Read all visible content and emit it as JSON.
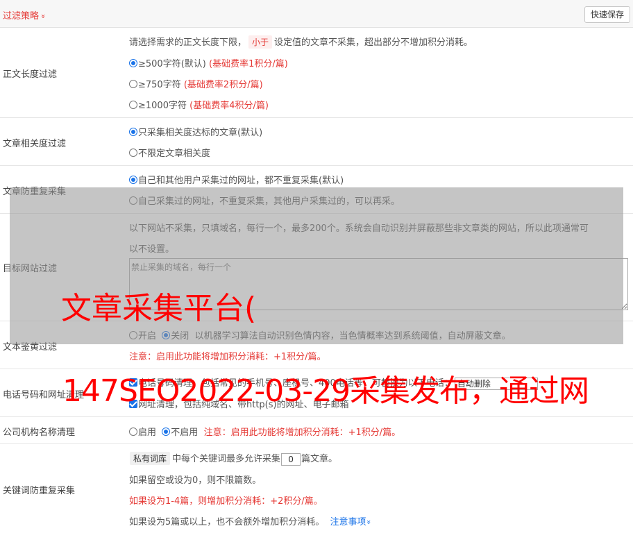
{
  "header": {
    "title": "过滤策略",
    "chevron": "»",
    "save_label": "快速保存"
  },
  "length_filter": {
    "label": "正文长度过滤",
    "desc_pre": "请选择需求的正文长度下限，",
    "desc_tag": "小于",
    "desc_post": "设定值的文章不采集，超出部分不增加积分消耗。",
    "options": [
      {
        "text": "≥500字符(默认)",
        "note": "(基础费率1积分/篇)",
        "selected": true
      },
      {
        "text": "≥750字符",
        "note": "(基础费率2积分/篇)",
        "selected": false
      },
      {
        "text": "≥1000字符",
        "note": "(基础费率4积分/篇)",
        "selected": false
      }
    ]
  },
  "relevance": {
    "label": "文章相关度过滤",
    "options": [
      {
        "text": "只采集相关度达标的文章(默认)",
        "selected": true
      },
      {
        "text": "不限定文章相关度",
        "selected": false
      }
    ]
  },
  "dedupe": {
    "label": "文章防重复采集",
    "options": [
      {
        "text": "自己和其他用户采集过的网址，都不重复采集(默认)",
        "selected": true
      },
      {
        "text": "自己采集过的网址，不重复采集，其他用户采集过的，可以再采。",
        "selected": false
      }
    ]
  },
  "site_filter": {
    "label": "目标网站过滤",
    "desc_line1": "以下网站不采集，只填域名，每行一个，最多200个。系统会自动识别并屏蔽那些非文章类的网站，所以此项通常可",
    "desc_line2": "以不设置。",
    "placeholder": "禁止采集的域名，每行一个"
  },
  "porn": {
    "label": "文本鉴黄过滤",
    "on_label": "开启",
    "off_label": "关闭",
    "desc": "以机器学习算法自动识别色情内容，当色情概率达到系统阈值，自动屏蔽文章。",
    "note": "注意：启用此功能将增加积分消耗：+1积分/篇。",
    "selected": "off"
  },
  "phone": {
    "label": "电话号码和网址清理",
    "phone_text": "电话号码清理，包括常见的手机号、座机号、400电话等，可替换为以下电话：",
    "phone_value": "自动删除",
    "url_text": "网址清理，包括纯域名、带http(s)的网址、电子邮箱"
  },
  "org": {
    "label": "公司机构名称清理",
    "on_label": "启用",
    "off_label": "不启用",
    "note": "注意：启用此功能将增加积分消耗：+1积分/篇。",
    "selected": "off"
  },
  "keyword": {
    "label": "关键词防重复采集",
    "tag": "私有词库",
    "line1_mid": "中每个关键词最多允许采集",
    "line1_value": "0",
    "line1_post": "篇文章。",
    "line2": "如果留空或设为0，则不限篇数。",
    "line3": "如果设为1-4篇，则增加积分消耗：+2积分/篇。",
    "line4": "如果设为5篇或以上，也不会额外增加积分消耗。",
    "link": "注意事项",
    "link_chevron": "»"
  },
  "watermark": {
    "line1": "文章采集平台(",
    "line2": "147SEO2022-03-29采集发布，通过网"
  }
}
